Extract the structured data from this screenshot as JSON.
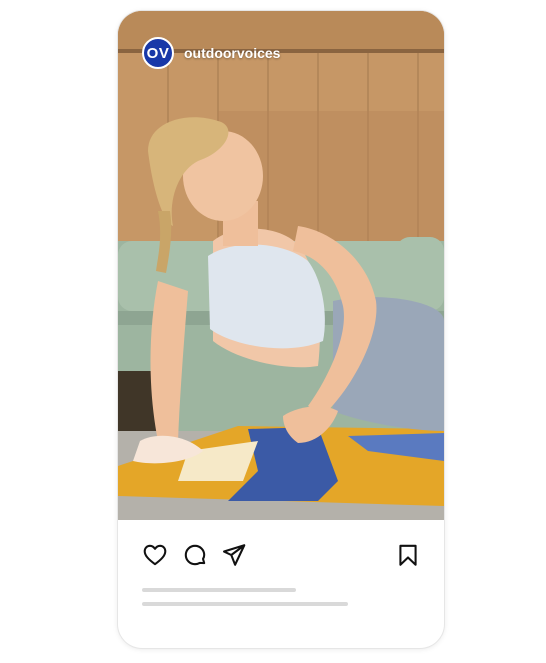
{
  "post": {
    "avatar_initials": "OV",
    "username": "outdoorvoices"
  },
  "icons": {
    "like": "heart-icon",
    "comment": "comment-icon",
    "share": "send-icon",
    "save": "bookmark-icon"
  },
  "colors": {
    "avatar": "#1838a8",
    "placeholder_lines": "#d9d9d9"
  }
}
